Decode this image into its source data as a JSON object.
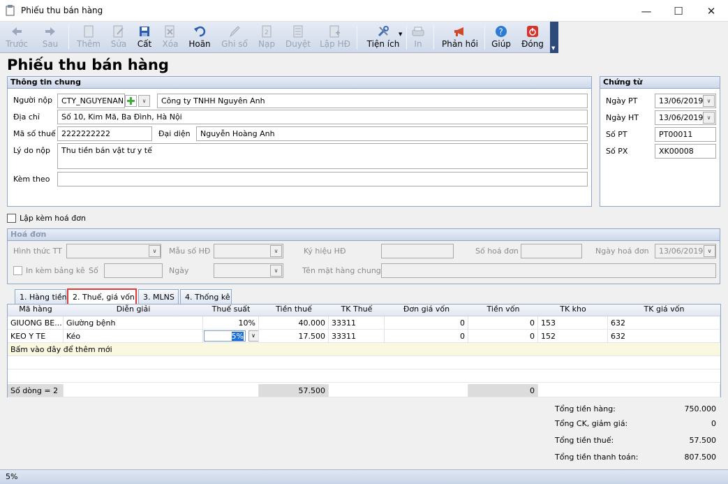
{
  "window": {
    "title": "Phiếu thu bán hàng",
    "minimize": "—",
    "maximize": "☐",
    "close": "✕"
  },
  "toolbar": {
    "back": "Trước",
    "forward": "Sau",
    "add": "Thêm",
    "edit": "Sửa",
    "save": "Cất",
    "delete": "Xóa",
    "undo": "Hoãn",
    "post": "Ghi sổ",
    "load": "Nạp",
    "approve": "Duyệt",
    "invoice": "Lập HĐ",
    "utilities": "Tiện ích",
    "print": "In",
    "feedback": "Phản hồi",
    "help": "Giúp",
    "close": "Đóng"
  },
  "page_title": "Phiếu thu bán hàng",
  "general": {
    "title": "Thông tin chung",
    "payer_label": "Người nộp",
    "payer_code": "CTY_NGUYENAN",
    "payer_name": "Công ty TNHH Nguyên Anh",
    "address_label": "Địa chỉ",
    "address": "Số 10, Kim Mã, Ba Đình, Hà Nội",
    "tax_label": "Mã số thuế",
    "tax_code": "2222222222",
    "rep_label": "Đại diện",
    "rep": "Nguyễn Hoàng Anh",
    "reason_label": "Lý do nộp",
    "reason": "Thu tiền bán vật tư y tế",
    "attach_label": "Kèm theo",
    "attach": ""
  },
  "voucher": {
    "title": "Chứng từ",
    "date_pt_label": "Ngày PT",
    "date_pt": "13/06/2019",
    "date_ht_label": "Ngày HT",
    "date_ht": "13/06/2019",
    "no_pt_label": "Số PT",
    "no_pt": "PT00011",
    "no_px_label": "Số PX",
    "no_px": "XK00008"
  },
  "with_invoice_label": "Lập kèm hoá đơn",
  "invoice": {
    "title": "Hoá đơn",
    "form_type_label": "Hình thức TT",
    "template_label": "Mẫu số HĐ",
    "symbol_label": "Ký hiệu HĐ",
    "inv_no_label": "Số hoá đơn",
    "inv_date_label": "Ngày hoá đơn",
    "inv_date": "13/06/2019",
    "print_list_label": "In kèm bảng kê",
    "no_label": "Số",
    "date_label": "Ngày",
    "common_name_label": "Tên mặt hàng chung"
  },
  "tabs": [
    "1. Hàng tiền",
    "2. Thuế, giá vốn",
    "3. MLNS",
    "4. Thống kê"
  ],
  "grid": {
    "headers": [
      "Mã hàng",
      "Diễn giải",
      "Thuế suất",
      "Tiền thuế",
      "TK Thuế",
      "Đơn giá vốn",
      "Tiền vốn",
      "TK kho",
      "TK giá vốn"
    ],
    "rows": [
      [
        "GIUONG BE...",
        "Giường bệnh",
        "10%",
        "40.000",
        "33311",
        "0",
        "0",
        "153",
        "632"
      ],
      [
        "KEO Y TE",
        "Kéo",
        "5%",
        "17.500",
        "33311",
        "0",
        "0",
        "152",
        "632"
      ]
    ],
    "new_row_hint": "Bấm vào đây để thêm mới",
    "footer_count": "Số dòng = 2",
    "footer_tax": "57.500",
    "footer_cost": "0"
  },
  "summary": {
    "goods_label": "Tổng tiền hàng:",
    "goods": "750.000",
    "discount_label": "Tổng CK, giảm giá:",
    "discount": "0",
    "tax_label": "Tổng tiền thuế:",
    "tax": "57.500",
    "payment_label": "Tổng tiền thanh toán:",
    "payment": "807.500"
  },
  "status": "5%"
}
